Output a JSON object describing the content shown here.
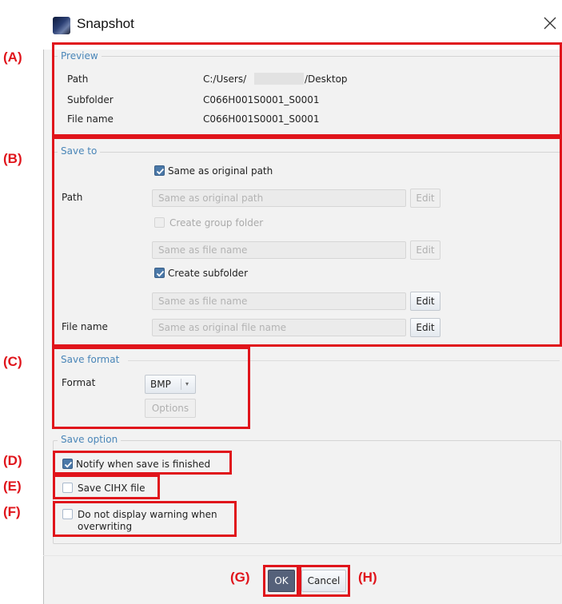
{
  "dialog": {
    "title": "Snapshot"
  },
  "preview": {
    "legend": "Preview",
    "rows": [
      {
        "label": "Path",
        "value_prefix": "C:/Users/",
        "value_suffix": "/Desktop"
      },
      {
        "label": "Subfolder",
        "value": "C066H001S0001_S0001"
      },
      {
        "label": "File name",
        "value": "C066H001S0001_S0001"
      }
    ]
  },
  "save_to": {
    "legend": "Save to",
    "same_as_original_path": {
      "label": "Same as original path",
      "checked": true
    },
    "path_label": "Path",
    "path_field_placeholder": "Same as original path",
    "edit_label": "Edit",
    "create_group_folder": {
      "label": "Create group folder",
      "checked": false,
      "enabled": false
    },
    "group_folder_placeholder": "Same as file name",
    "create_subfolder": {
      "label": "Create subfolder",
      "checked": true
    },
    "subfolder_placeholder": "Same as file name",
    "file_name_label": "File name",
    "file_name_placeholder": "Same as original file name"
  },
  "save_format": {
    "legend": "Save format",
    "format_label": "Format",
    "format_value": "BMP",
    "options_label": "Options"
  },
  "save_option": {
    "legend": "Save option",
    "notify": {
      "label": "Notify when save is finished",
      "checked": true
    },
    "save_cihx": {
      "label": "Save CIHX file",
      "checked": false
    },
    "no_warning": {
      "label_line1": "Do not display warning when",
      "label_line2": "overwriting",
      "checked": false
    }
  },
  "footer": {
    "ok_label": "OK",
    "cancel_label": "Cancel"
  },
  "annotations": {
    "A": "(A)",
    "B": "(B)",
    "C": "(C)",
    "D": "(D)",
    "E": "(E)",
    "F": "(F)",
    "G": "(G)",
    "H": "(H)",
    "color": "#e0141b"
  },
  "colors": {
    "legend": "#4a86b8",
    "checkbox_checked": "#4a78a8",
    "dialog_bg": "#f2f2f2"
  }
}
